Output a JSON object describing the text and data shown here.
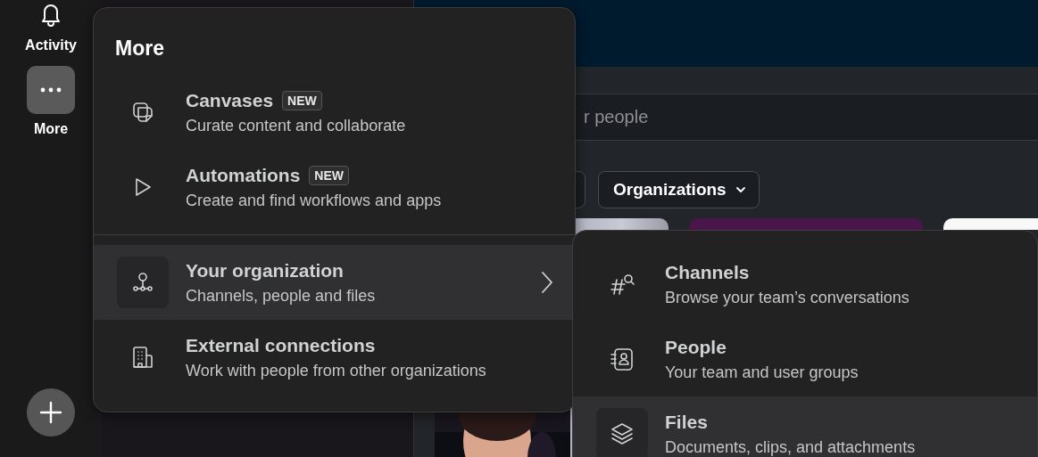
{
  "rail": {
    "items": [
      {
        "label": "Activity",
        "selected": false
      },
      {
        "label": "More",
        "selected": true
      }
    ]
  },
  "main": {
    "search": {
      "placeholder": "r people"
    },
    "filters": [
      {
        "label": "Organizations"
      }
    ]
  },
  "more_menu": {
    "title": "More",
    "groups": [
      {
        "items": [
          {
            "title": "Canvases",
            "badge": "NEW",
            "subtitle": "Curate content and collaborate",
            "selected": false,
            "submenu": false
          },
          {
            "title": "Automations",
            "badge": "NEW",
            "subtitle": "Create and find workflows and apps",
            "selected": false,
            "submenu": false
          }
        ]
      },
      {
        "items": [
          {
            "title": "Your organization",
            "subtitle": "Channels, people and files",
            "selected": true,
            "submenu": true
          },
          {
            "title": "External connections",
            "subtitle": "Work with people from other organizations",
            "selected": false,
            "submenu": false
          }
        ]
      }
    ]
  },
  "submenu": {
    "items": [
      {
        "title": "Channels",
        "subtitle": "Browse your team’s conversations",
        "selected": false
      },
      {
        "title": "People",
        "subtitle": "Your team and user groups",
        "selected": false
      },
      {
        "title": "Files",
        "subtitle": "Documents, clips, and attachments",
        "selected": true
      }
    ]
  }
}
